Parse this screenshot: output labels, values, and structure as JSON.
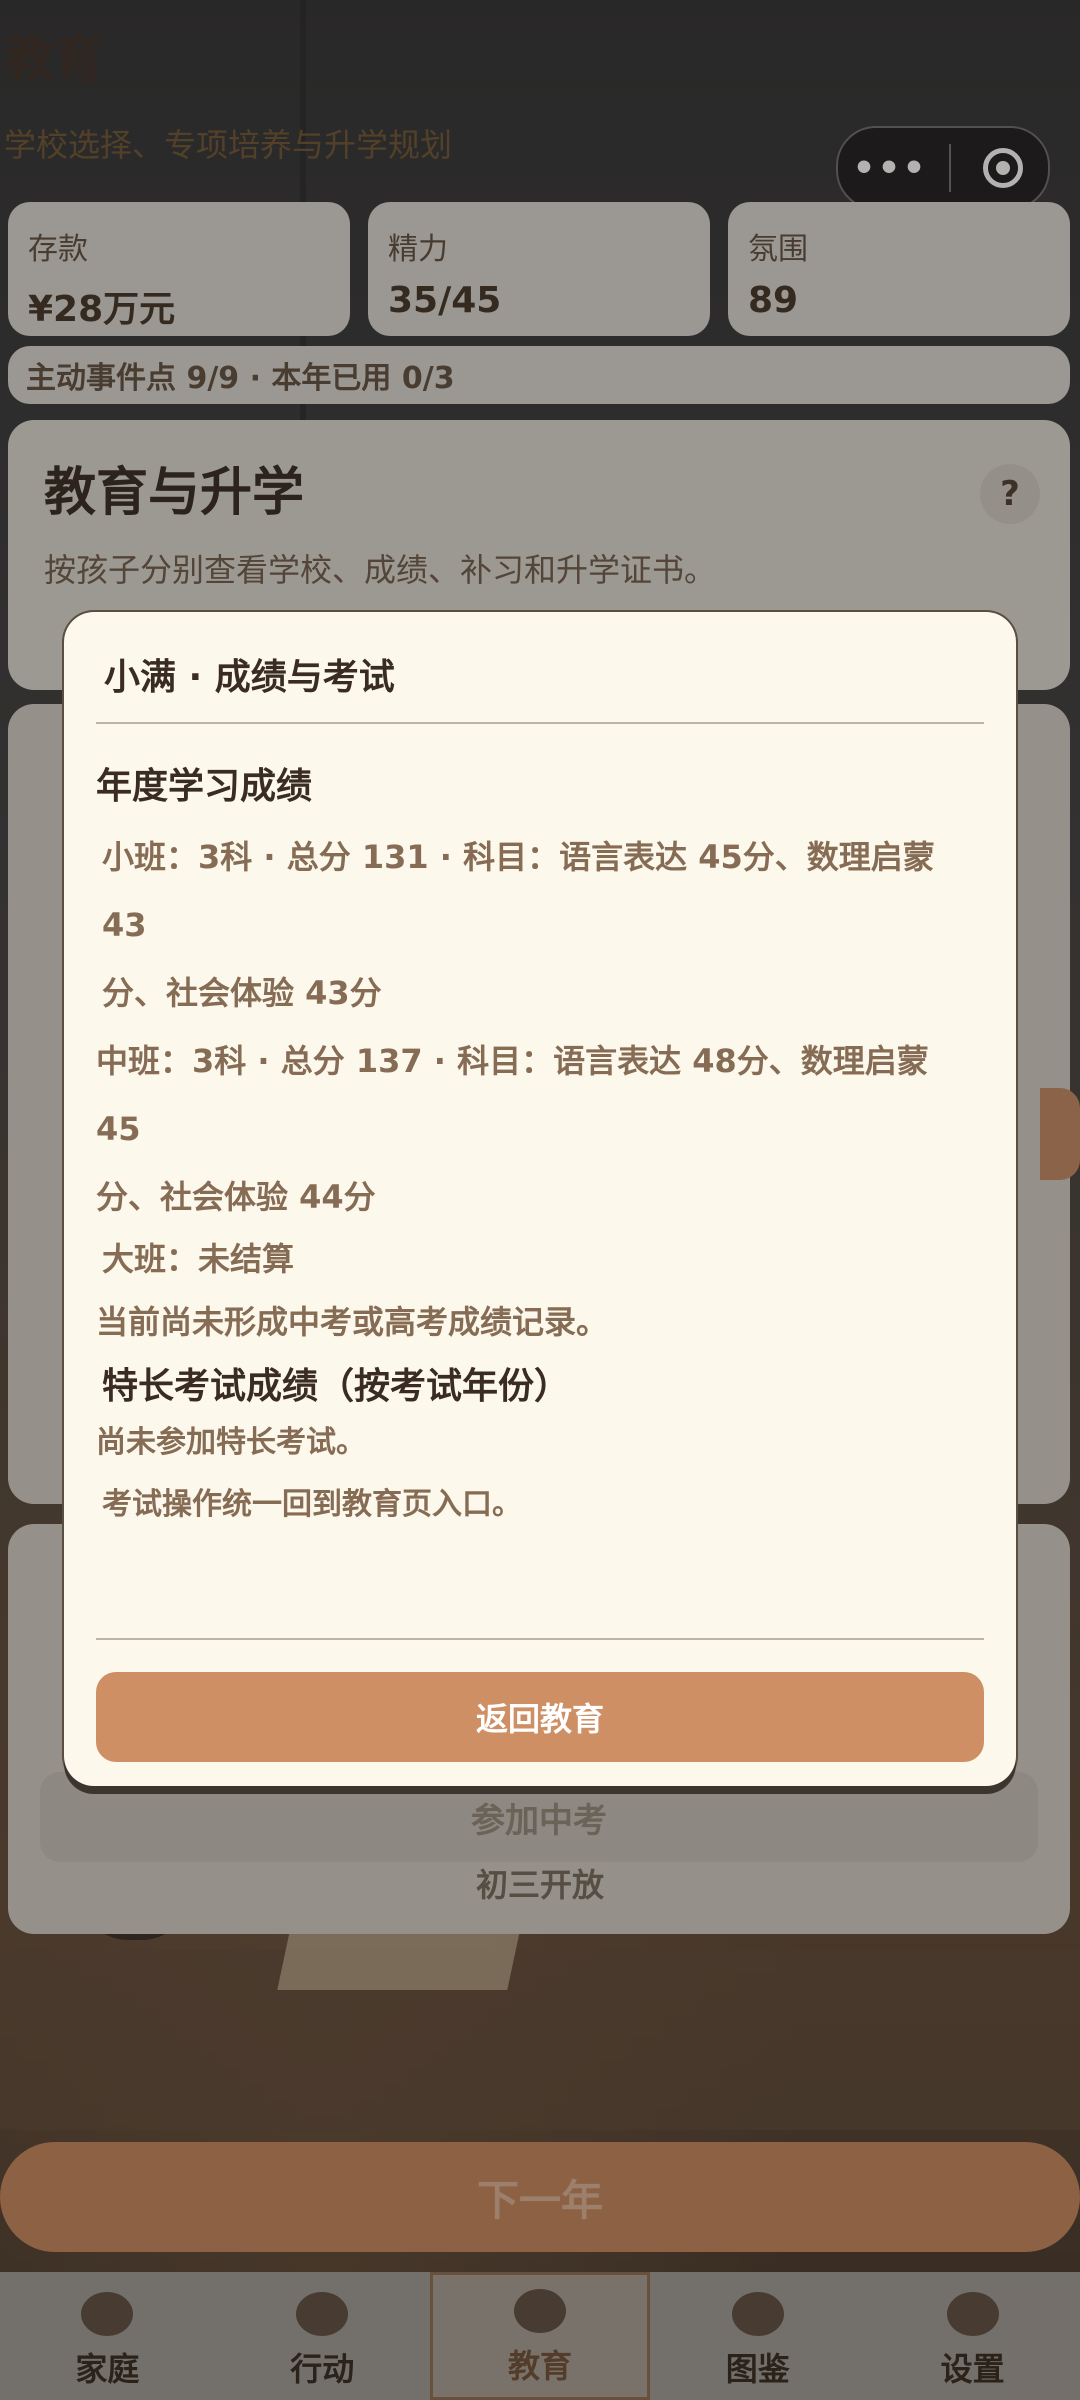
{
  "header": {
    "page_heading": "教育",
    "page_sub": "学校选择、专项培养与升学规划"
  },
  "capsule": {
    "more_icon": "•••",
    "target_icon": "record-icon"
  },
  "stats": [
    {
      "label": "存款",
      "value": "¥28万元"
    },
    {
      "label": "精力",
      "value": "35/45"
    },
    {
      "label": "氛围",
      "value": "89"
    }
  ],
  "event_bar": "主动事件点 9/9 · 本年已用 0/3",
  "section": {
    "title": "教育与升学",
    "desc": "按孩子分别查看学校、成绩、补习和升学证书。",
    "help": "?"
  },
  "background_actions": {
    "exam_button": "参加中考",
    "exam_note": "初三开放",
    "next_year": "下一年"
  },
  "tabs": [
    {
      "label": "家庭",
      "icon": "house-icon"
    },
    {
      "label": "行动",
      "icon": "action-icon"
    },
    {
      "label": "教育",
      "icon": "book-icon",
      "active": true
    },
    {
      "label": "图鉴",
      "icon": "album-icon"
    },
    {
      "label": "设置",
      "icon": "gear-icon"
    }
  ],
  "modal": {
    "title": "小满 · 成绩与考试",
    "annual_heading": "年度学习成绩",
    "annual_lines": [
      "小班：3科 · 总分 131 · 科目：语言表达 45分、数理启蒙 43",
      "分、社会体验 43分",
      "中班：3科 · 总分 137 · 科目：语言表达 48分、数理启蒙 45",
      "分、社会体验 44分",
      "大班：未结算"
    ],
    "no_record": "当前尚未形成中考或高考成绩记录。",
    "talent_heading": "特长考试成绩（按考试年份）",
    "talent_none": "尚未参加特长考试。",
    "talent_note": "考试操作统一回到教育页入口。",
    "return_button": "返回教育"
  }
}
